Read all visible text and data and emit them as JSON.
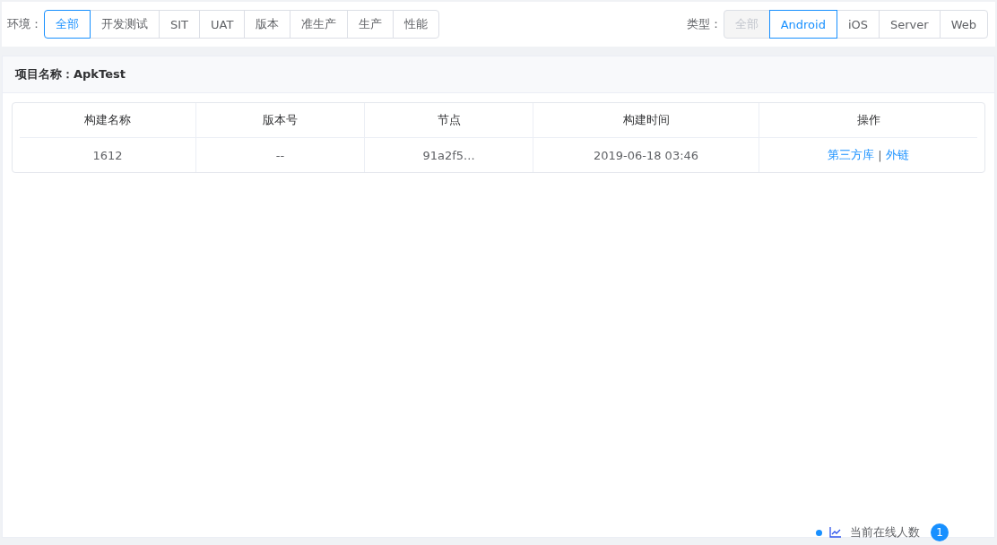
{
  "env_filter": {
    "label": "环境：",
    "options": [
      {
        "label": "全部",
        "selected": true,
        "disabled": false
      },
      {
        "label": "开发测试",
        "selected": false,
        "disabled": false
      },
      {
        "label": "SIT",
        "selected": false,
        "disabled": false
      },
      {
        "label": "UAT",
        "selected": false,
        "disabled": false
      },
      {
        "label": "版本",
        "selected": false,
        "disabled": false
      },
      {
        "label": "准生产",
        "selected": false,
        "disabled": false
      },
      {
        "label": "生产",
        "selected": false,
        "disabled": false
      },
      {
        "label": "性能",
        "selected": false,
        "disabled": false
      }
    ]
  },
  "type_filter": {
    "label": "类型：",
    "options": [
      {
        "label": "全部",
        "selected": false,
        "disabled": true
      },
      {
        "label": "Android",
        "selected": true,
        "disabled": false
      },
      {
        "label": "iOS",
        "selected": false,
        "disabled": false
      },
      {
        "label": "Server",
        "selected": false,
        "disabled": false
      },
      {
        "label": "Web",
        "selected": false,
        "disabled": false
      }
    ]
  },
  "panel": {
    "title_label": "项目名称：",
    "title_value": "ApkTest"
  },
  "table": {
    "columns": [
      "构建名称",
      "版本号",
      "节点",
      "构建时间",
      "操作"
    ],
    "rows": [
      {
        "cells": [
          "1612",
          "--",
          "91a2f5...",
          "2019-06-18 03:46"
        ],
        "actions": [
          "第三方库",
          "外链"
        ],
        "separator": "|"
      }
    ]
  },
  "online": {
    "label": "当前在线人数",
    "count": "1"
  }
}
